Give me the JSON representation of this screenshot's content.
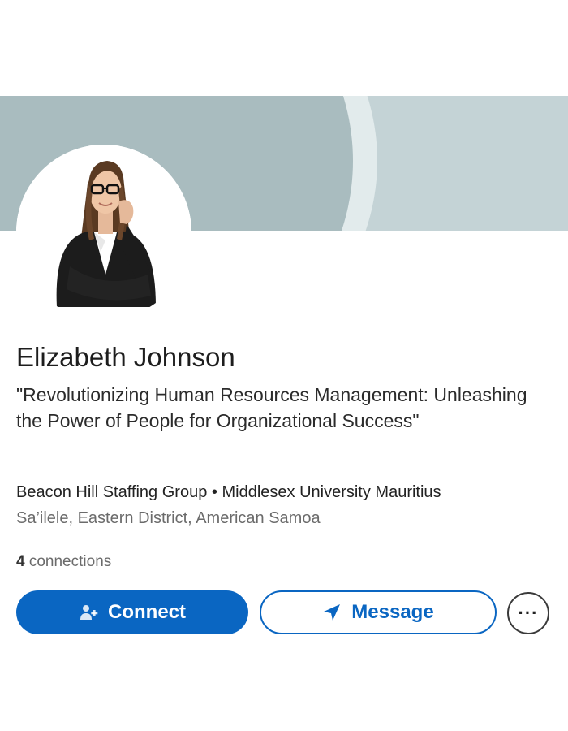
{
  "profile": {
    "name": "Elizabeth Johnson",
    "headline": "\"Revolutionizing Human Resources Management: Unleashing the Power of People for Organizational Success\"",
    "company": "Beacon Hill Staffing Group",
    "separator": "•",
    "school": "Middlesex University Mauritius",
    "location": "Sa’ilele, Eastern District, American Samoa",
    "connections_count": "4",
    "connections_label": "connections"
  },
  "actions": {
    "connect_label": "Connect",
    "message_label": "Message",
    "more_label": "···"
  },
  "icons": {
    "connect": "add-person-icon",
    "message": "send-icon",
    "more": "more-options-icon"
  },
  "colors": {
    "accent": "#0a66c2",
    "banner": "#a9bcbf",
    "banner_light": "#c4d3d6"
  }
}
